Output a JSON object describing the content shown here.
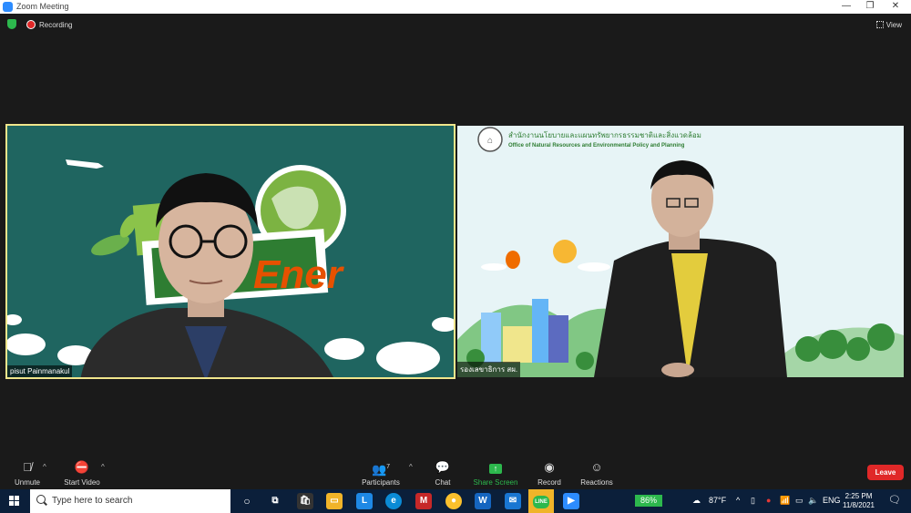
{
  "window": {
    "title": "Zoom Meeting"
  },
  "meeting": {
    "recording_label": "Recording",
    "view_label": "View"
  },
  "participants": [
    {
      "name": "pisut Painmanakul",
      "bg_text": "Ener"
    },
    {
      "name": "รองเลขาธิการ สผ.",
      "org_thai": "สำนักงานนโยบายและแผนทรัพยากรธรรมชาติและสิ่งแวดล้อม",
      "org_english": "Office of Natural Resources and Environmental Policy and Planning"
    }
  ],
  "toolbar": {
    "unmute": "Unmute",
    "start_video": "Start Video",
    "participants": "Participants",
    "participants_count": "7",
    "chat": "Chat",
    "share_screen": "Share Screen",
    "record": "Record",
    "reactions": "Reactions",
    "leave": "Leave"
  },
  "taskbar": {
    "search_placeholder": "Type here to search",
    "battery": "86%",
    "temperature": "87°F",
    "language": "ENG",
    "time": "2:25 PM",
    "date": "11/8/2021"
  },
  "colors": {
    "accent_green": "#2db84d",
    "leave_red": "#e02828",
    "active_speaker": "#f0e68c"
  }
}
